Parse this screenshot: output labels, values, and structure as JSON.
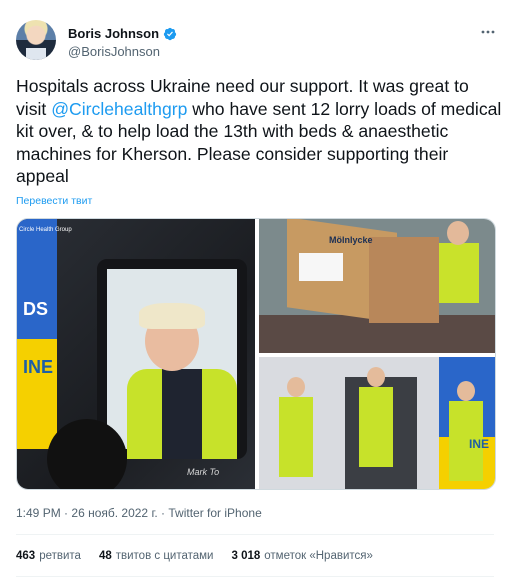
{
  "author": {
    "display_name": "Boris Johnson",
    "handle": "@BorisJohnson",
    "verified_icon": "verified-badge-icon",
    "verified_color": "#1d9bf0"
  },
  "tweet": {
    "text_before": "Hospitals across Ukraine need our support. It was great to visit ",
    "mention": "@Circlehealthgrp",
    "text_after": " who have sent 12 lorry loads of medical kit over, & to help load the 13th with beds & anaesthetic machines for Kherson. Please consider supporting their appeal",
    "translate_link": "Перевести твит"
  },
  "media": {
    "photo_1": {
      "flag_text_1": "DS",
      "flag_text_2": "INE",
      "logo_text": "Circle Health Group",
      "signature": "Mark To"
    },
    "photo_2": {
      "box_text": "Mölnlycke"
    },
    "photo_3": {
      "banner_text": "INE"
    }
  },
  "meta": {
    "time": "1:49 PM",
    "date": "26 нояб. 2022 г.",
    "source": "Twitter for iPhone",
    "separator": "·"
  },
  "stats": {
    "retweets_count": "463",
    "retweets_label": "ретвита",
    "quotes_count": "48",
    "quotes_label": "твитов с цитатами",
    "likes_count": "3 018",
    "likes_label": "отметок «Нравится»"
  },
  "colors": {
    "link": "#1d9bf0",
    "secondary_text": "#536471",
    "primary_text": "#0f1419"
  }
}
